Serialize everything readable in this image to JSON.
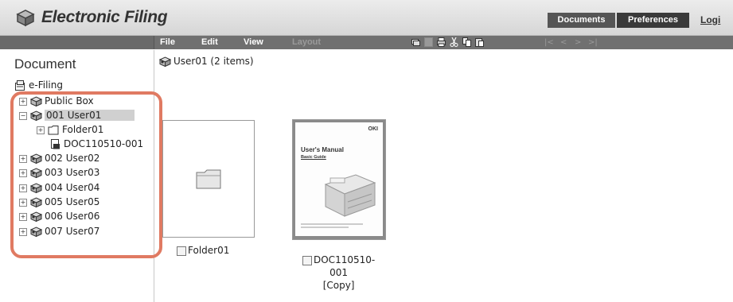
{
  "header": {
    "title": "Electronic Filing",
    "nav": {
      "documents": "Documents",
      "preferences": "Preferences"
    },
    "login": "Logi"
  },
  "toolbar": {
    "menus": [
      "File",
      "Edit",
      "View",
      "Layout"
    ],
    "icons": [
      "properties-icon",
      "save-icon",
      "print-icon",
      "cut-icon",
      "copy-icon",
      "paste-icon"
    ],
    "nav": [
      "|<",
      "<",
      ">",
      ">|"
    ]
  },
  "sidebar": {
    "title": "Document",
    "root": "e-Filing",
    "items": [
      {
        "label": "Public Box",
        "icon": "box-icon",
        "expander": "+"
      },
      {
        "label": "001 User01",
        "icon": "user-box-icon",
        "expander": "−",
        "selected": true
      },
      {
        "label": "Folder01",
        "icon": "folder-icon",
        "expander": "+"
      },
      {
        "label": "DOC110510-001",
        "icon": "document-icon",
        "expander": ""
      },
      {
        "label": "002 User02",
        "icon": "user-box-icon",
        "expander": "+"
      },
      {
        "label": "003 User03",
        "icon": "user-box-icon",
        "expander": "+"
      },
      {
        "label": "004 User04",
        "icon": "user-box-icon",
        "expander": "+"
      },
      {
        "label": "005 User05",
        "icon": "user-box-icon",
        "expander": "+"
      },
      {
        "label": "006 User06",
        "icon": "user-box-icon",
        "expander": "+"
      },
      {
        "label": "007 User07",
        "icon": "user-box-icon",
        "expander": "+"
      }
    ]
  },
  "content": {
    "breadcrumb": "User01  (2 items)",
    "items": [
      {
        "name": "Folder01",
        "type": "folder"
      },
      {
        "name_lines": [
          "DOC110510-",
          "001",
          "[Copy]"
        ],
        "type": "document",
        "thumb": {
          "brand": "OKI",
          "title": "User's Manual",
          "subtitle": "Basic Guide"
        }
      }
    ]
  },
  "colors": {
    "highlight": "#e07a62",
    "toolbar": "#707070",
    "header_btn": "#3a3a3a"
  }
}
